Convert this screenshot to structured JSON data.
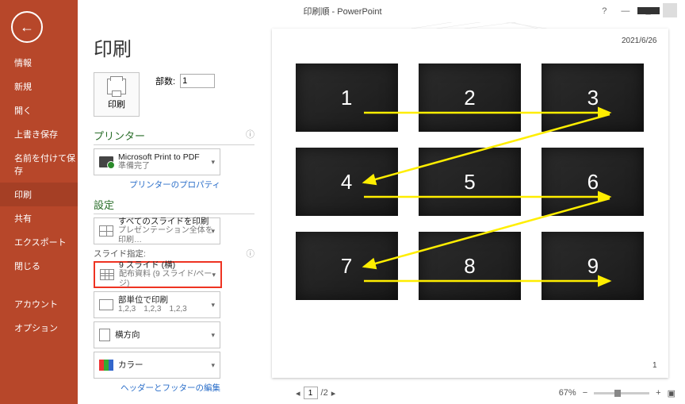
{
  "window": {
    "title": "印刷順 - PowerPoint"
  },
  "sidebar": {
    "items": [
      {
        "label": "情報"
      },
      {
        "label": "新規"
      },
      {
        "label": "開く"
      },
      {
        "label": "上書き保存"
      },
      {
        "label": "名前を付けて保存"
      },
      {
        "label": "印刷",
        "selected": true
      },
      {
        "label": "共有"
      },
      {
        "label": "エクスポート"
      },
      {
        "label": "閉じる"
      }
    ],
    "footer": [
      {
        "label": "アカウント"
      },
      {
        "label": "オプション"
      }
    ]
  },
  "page": {
    "heading": "印刷",
    "printBtn": "印刷",
    "copiesLabel": "部数:",
    "copiesValue": "1",
    "printerHeader": "プリンター",
    "printerName": "Microsoft Print to PDF",
    "printerStatus": "準備完了",
    "printerProps": "プリンターのプロパティ",
    "settingsHeader": "設定",
    "scope1": "すべてのスライドを印刷",
    "scope2": "プレゼンテーション全体を印刷…",
    "slideDesignLabel": "スライド指定:",
    "layout1": "9 スライド (横)",
    "layout2": "配布資料 (9 スライド/ページ)",
    "collate1": "部単位で印刷",
    "collate2": "1,2,3　1,2,3　1,2,3",
    "orientation": "横方向",
    "color": "カラー",
    "hfLink": "ヘッダーとフッターの編集"
  },
  "preview": {
    "date": "2021/6/26",
    "pageNo": "1",
    "slides": [
      "1",
      "2",
      "3",
      "4",
      "5",
      "6",
      "7",
      "8",
      "9"
    ],
    "curPage": "1",
    "totalPages": "2",
    "zoom": "67%"
  }
}
